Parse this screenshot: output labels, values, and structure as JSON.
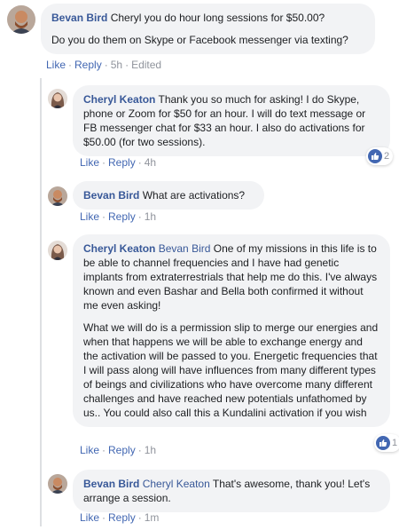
{
  "colors": {
    "accent": "#4267b2",
    "name": "#385898",
    "bubble": "#f2f3f5",
    "muted": "#90949c"
  },
  "comments": [
    {
      "author": "Bevan Bird",
      "mention": "",
      "paragraphs": [
        "Cheryl you do hour long sessions for $50.00?",
        "Do you do them on Skype or Facebook messenger via texting?"
      ],
      "like": "Like",
      "reply": "Reply",
      "time": "5h",
      "edited": "Edited",
      "avatar_icon": "man-avatar"
    },
    {
      "author": "Cheryl Keaton",
      "mention": "",
      "paragraphs": [
        "Thank you so much for asking! I do Skype, phone or Zoom for $50 for an hour. I will do text message or FB messenger chat for $33 an hour. I also do activations for $50.00 (for two sessions)."
      ],
      "like": "Like",
      "reply": "Reply",
      "time": "4h",
      "reaction_count": "2",
      "avatar_icon": "woman-avatar"
    },
    {
      "author": "Bevan Bird",
      "mention": "",
      "paragraphs": [
        "What are activations?"
      ],
      "like": "Like",
      "reply": "Reply",
      "time": "1h",
      "avatar_icon": "man-avatar"
    },
    {
      "author": "Cheryl Keaton",
      "mention": "Bevan Bird",
      "paragraphs": [
        "One of my missions in this life is to be able to channel frequencies and I have had genetic implants from extraterrestrials that help me do this. I've always known and even Bashar and Bella both confirmed it without me even asking!",
        "What we will do is a permission slip to merge our energies and when that happens we will be able to exchange energy and the activation will be passed to you. Energetic frequencies that I will pass along will have influences from many different types of beings and civilizations who have overcome many different challenges and have reached new potentials unfathomed by us.. You could also call this a Kundalini activation if you wish"
      ],
      "like": "Like",
      "reply": "Reply",
      "time": "1h",
      "reaction_count": "1",
      "avatar_icon": "woman-avatar"
    },
    {
      "author": "Bevan Bird",
      "mention": "Cheryl Keaton",
      "paragraphs": [
        "That's awesome, thank you! Let's arrange a session."
      ],
      "like": "Like",
      "reply": "Reply",
      "time": "1m",
      "avatar_icon": "man-avatar"
    }
  ]
}
